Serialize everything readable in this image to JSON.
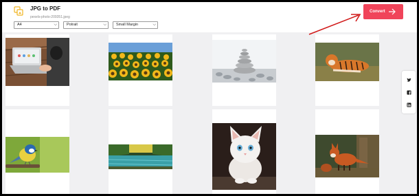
{
  "app": {
    "title": "JPG to PDF",
    "file_name": "pexels-photo-209351.jpeg"
  },
  "options": {
    "page_size": "A4",
    "orientation": "Potrait",
    "margin": "Small Margin"
  },
  "toolbar": {
    "convert_label": "Convert"
  },
  "colors": {
    "accent": "#f0445a",
    "annotation": "#d11a1a",
    "background": "#f0f0f2"
  },
  "images": [
    {
      "name": "laptop-desk-photo"
    },
    {
      "name": "sunflowers-photo"
    },
    {
      "name": "stacked-stones-photo"
    },
    {
      "name": "tiger-photo"
    },
    {
      "name": "blue-tit-bird-photo"
    },
    {
      "name": "lake-landscape-photo"
    },
    {
      "name": "white-kitten-photo"
    },
    {
      "name": "fox-photo"
    }
  ],
  "share": {
    "icons": [
      "twitter-icon",
      "facebook-icon",
      "linkedin-icon"
    ]
  }
}
